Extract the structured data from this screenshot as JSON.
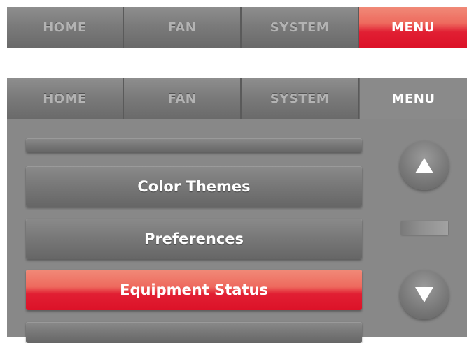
{
  "top_tabs": {
    "home": "HOME",
    "fan": "FAN",
    "system": "SYSTEM",
    "menu": "MENU"
  },
  "menu_tabs": {
    "home": "HOME",
    "fan": "FAN",
    "system": "SYSTEM",
    "menu": "MENU"
  },
  "menu_items": [
    {
      "label": ""
    },
    {
      "label": "Color Themes"
    },
    {
      "label": "Preferences"
    },
    {
      "label": "Equipment Status",
      "selected": true
    },
    {
      "label": ""
    }
  ],
  "icons": {
    "scroll_up": "triangle-up-icon",
    "scroll_down": "triangle-down-icon"
  },
  "colors": {
    "accent": "#e11f33",
    "tab_bg": "#7b7b7b",
    "panel_bg": "#888888"
  }
}
